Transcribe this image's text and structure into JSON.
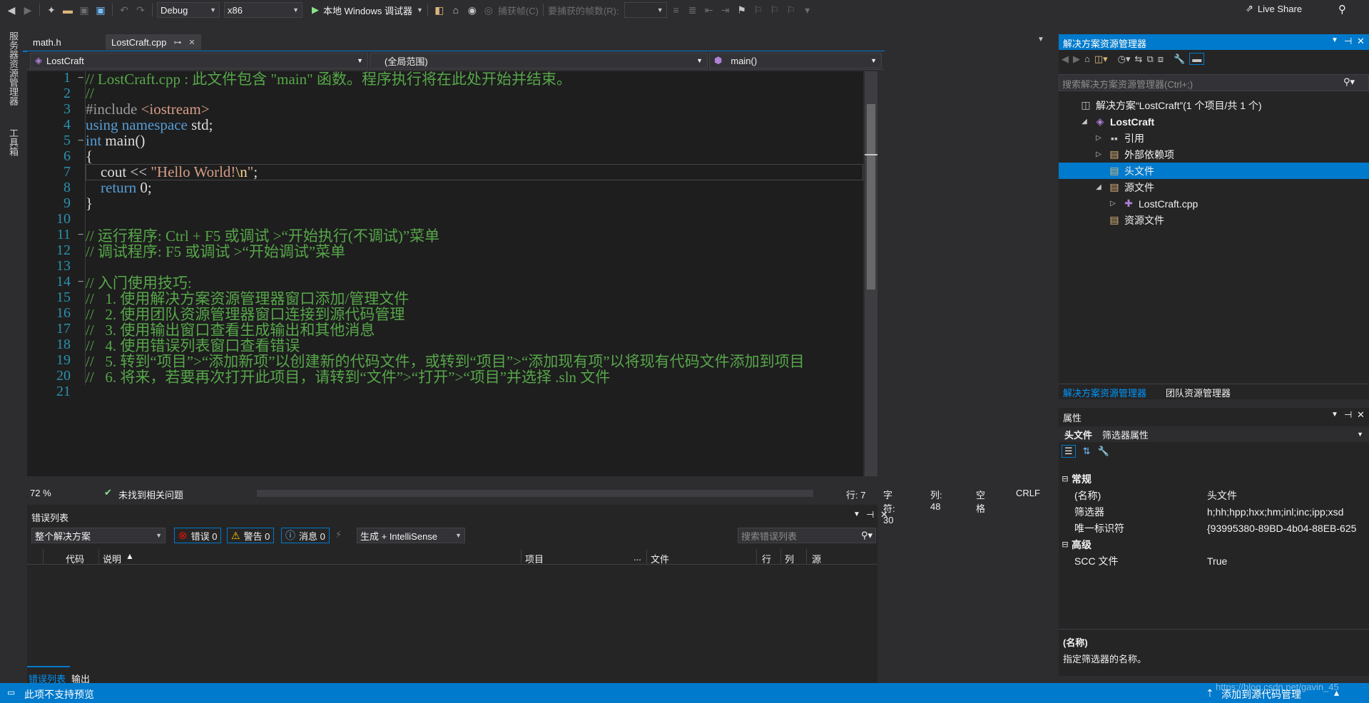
{
  "toolbar": {
    "config": "Debug",
    "platform": "x86",
    "run_label": "本地 Windows 调试器",
    "capture_label": "捕获帧(C)",
    "frames_label": "要捕获的帧数(R):",
    "live_share": "Live Share"
  },
  "left_strip": {
    "server_explorer": "服务器资源管理器",
    "toolbox": "工具箱"
  },
  "tabs": [
    {
      "label": "math.h"
    },
    {
      "label": "LostCraft.cpp",
      "pin": "⊶",
      "close": "✕"
    }
  ],
  "navbar": {
    "project": "LostCraft",
    "scope": "(全局范围)",
    "member": "main()"
  },
  "code_lines": [
    {
      "n": "1",
      "segs": [
        {
          "t": "// LostCraft.cpp : 此文件包含 \"main\" 函数。程序执行将在此处开始并结束。",
          "c": "cm"
        }
      ]
    },
    {
      "n": "2",
      "segs": [
        {
          "t": "//",
          "c": "cm"
        }
      ]
    },
    {
      "n": "3",
      "segs": [
        {
          "t": "#include ",
          "c": "pp"
        },
        {
          "t": "<iostream>",
          "c": "str"
        }
      ]
    },
    {
      "n": "4",
      "segs": [
        {
          "t": "using namespace ",
          "c": "kw"
        },
        {
          "t": "std;",
          "c": ""
        }
      ]
    },
    {
      "n": "5",
      "segs": [
        {
          "t": "int ",
          "c": "kw"
        },
        {
          "t": "main()",
          "c": ""
        }
      ]
    },
    {
      "n": "6",
      "segs": [
        {
          "t": "{",
          "c": ""
        }
      ]
    },
    {
      "n": "7",
      "segs": [
        {
          "t": "    cout << ",
          "c": ""
        },
        {
          "t": "\"Hello World!",
          "c": "str"
        },
        {
          "t": "\\n",
          "c": "esc"
        },
        {
          "t": "\"",
          "c": "str"
        },
        {
          "t": ";",
          "c": ""
        }
      ]
    },
    {
      "n": "8",
      "segs": [
        {
          "t": "    return ",
          "c": "kw"
        },
        {
          "t": "0;",
          "c": ""
        }
      ]
    },
    {
      "n": "9",
      "segs": [
        {
          "t": "}",
          "c": ""
        }
      ]
    },
    {
      "n": "10",
      "segs": []
    },
    {
      "n": "11",
      "segs": [
        {
          "t": "// 运行程序: Ctrl + F5 或调试 >“开始执行(不调试)”菜单",
          "c": "cm"
        }
      ]
    },
    {
      "n": "12",
      "segs": [
        {
          "t": "// 调试程序: F5 或调试 >“开始调试”菜单",
          "c": "cm"
        }
      ]
    },
    {
      "n": "13",
      "segs": []
    },
    {
      "n": "14",
      "segs": [
        {
          "t": "// 入门使用技巧:",
          "c": "cm"
        }
      ]
    },
    {
      "n": "15",
      "segs": [
        {
          "t": "//   1. 使用解决方案资源管理器窗口添加/管理文件",
          "c": "cm"
        }
      ]
    },
    {
      "n": "16",
      "segs": [
        {
          "t": "//   2. 使用团队资源管理器窗口连接到源代码管理",
          "c": "cm"
        }
      ]
    },
    {
      "n": "17",
      "segs": [
        {
          "t": "//   3. 使用输出窗口查看生成输出和其他消息",
          "c": "cm"
        }
      ]
    },
    {
      "n": "18",
      "segs": [
        {
          "t": "//   4. 使用错误列表窗口查看错误",
          "c": "cm"
        }
      ]
    },
    {
      "n": "19",
      "segs": [
        {
          "t": "//   5. 转到“项目”>“添加新项”以创建新的代码文件，或转到“项目”>“添加现有项”以将现有代码文件添加到项目",
          "c": "cm"
        }
      ]
    },
    {
      "n": "20",
      "segs": [
        {
          "t": "//   6. 将来，若要再次打开此项目，请转到“文件”>“打开”>“项目”并选择 .sln 文件",
          "c": "cm"
        }
      ]
    },
    {
      "n": "21",
      "segs": []
    }
  ],
  "editor_status": {
    "zoom": "72 %",
    "issues": "未找到相关问题",
    "row": "行: 7",
    "char": "字符: 30",
    "col": "列: 48",
    "spaces": "空格",
    "eol": "CRLF"
  },
  "error_list": {
    "title": "错误列表",
    "scope": "整个解决方案",
    "errors": "错误 0",
    "warnings": "警告 0",
    "messages": "消息 0",
    "build": "生成 + IntelliSense",
    "search_placeholder": "搜索错误列表",
    "columns": {
      "code": "代码",
      "desc": "说明",
      "project": "项目",
      "dots": "...",
      "file": "文件",
      "line": "行",
      "col": "列",
      "src": "源"
    },
    "bottom_tabs": [
      "错误列表",
      "输出"
    ]
  },
  "solution_explorer": {
    "title": "解决方案资源管理器",
    "search_placeholder": "搜索解决方案资源管理器(Ctrl+;)",
    "items": [
      {
        "label": "解决方案“LostCraft”(1 个项目/共 1 个)",
        "indent": 0,
        "arrow": ""
      },
      {
        "label": "LostCraft",
        "indent": 1,
        "arrow": "◢"
      },
      {
        "label": "引用",
        "indent": 2,
        "arrow": "▷"
      },
      {
        "label": "外部依赖项",
        "indent": 2,
        "arrow": "▷"
      },
      {
        "label": "头文件",
        "indent": 2,
        "arrow": ""
      },
      {
        "label": "源文件",
        "indent": 2,
        "arrow": "◢"
      },
      {
        "label": "LostCraft.cpp",
        "indent": 3,
        "arrow": "▷"
      },
      {
        "label": "资源文件",
        "indent": 2,
        "arrow": ""
      }
    ],
    "bottom_tabs": [
      "解决方案资源管理器",
      "团队资源管理器"
    ]
  },
  "properties": {
    "title": "属性",
    "object": "头文件",
    "object_type": "筛选器属性",
    "cat_general": "常规",
    "rows_general": [
      {
        "k": "(名称)",
        "v": "头文件"
      },
      {
        "k": "筛选器",
        "v": "h;hh;hpp;hxx;hm;inl;inc;ipp;xsd"
      },
      {
        "k": "唯一标识符",
        "v": "{93995380-89BD-4b04-88EB-625"
      }
    ],
    "cat_advanced": "高级",
    "rows_advanced": [
      {
        "k": "SCC 文件",
        "v": "True"
      }
    ],
    "desc_title": "(名称)",
    "desc_text": "指定筛选器的名称。"
  },
  "statusbar": {
    "left": "此项不支持预览",
    "right": "添加到源代码管理",
    "watermark": "https://blog.csdn.net/gavin_45"
  }
}
